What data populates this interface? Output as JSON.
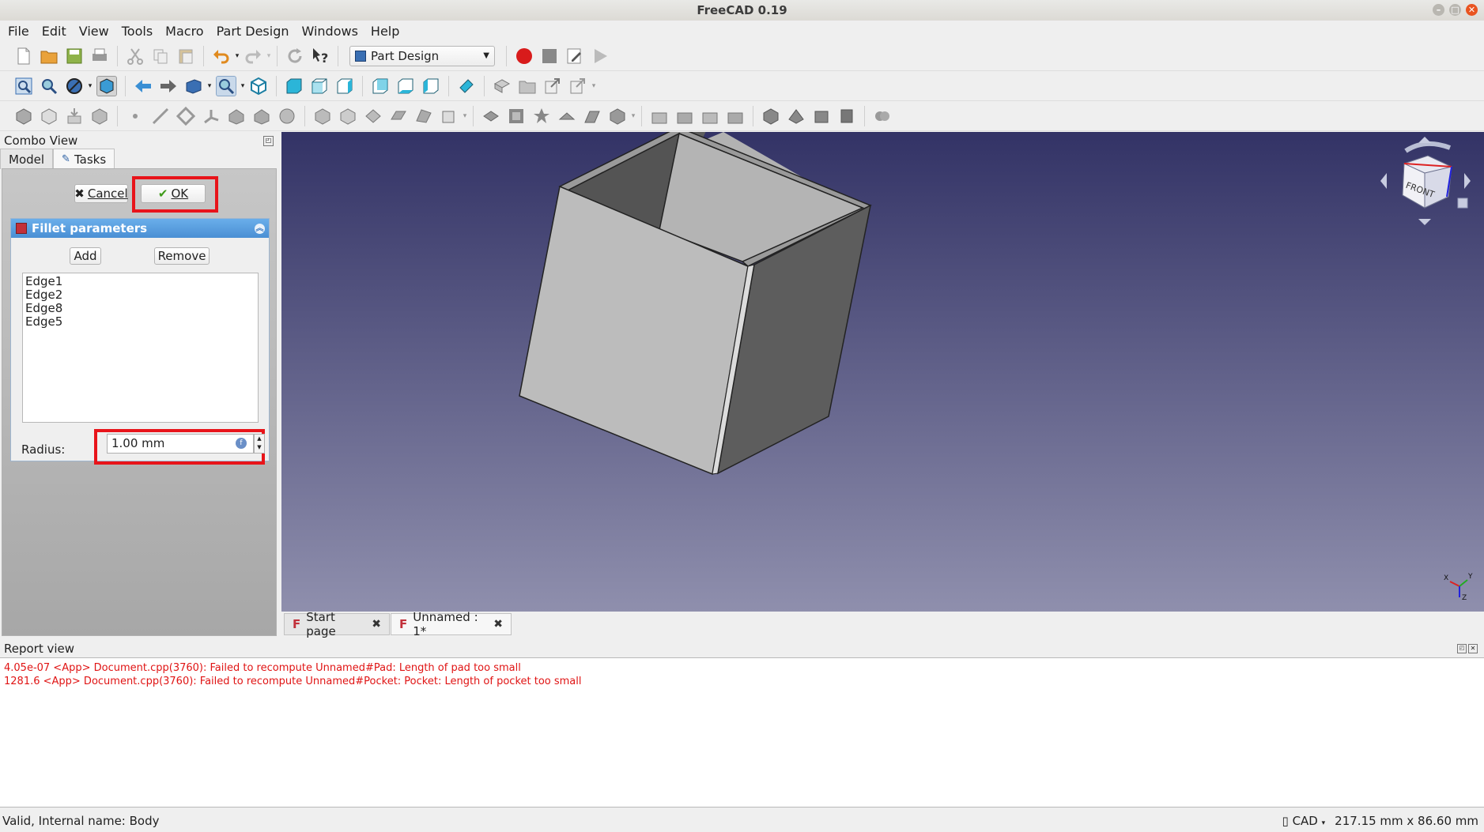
{
  "window": {
    "title": "FreeCAD 0.19"
  },
  "menu": [
    "File",
    "Edit",
    "View",
    "Tools",
    "Macro",
    "Part Design",
    "Windows",
    "Help"
  ],
  "workbench": {
    "selected": "Part Design"
  },
  "combo_view": {
    "title": "Combo View",
    "tabs": [
      "Model",
      "Tasks"
    ],
    "active_tab": "Tasks",
    "cancel_label": "Cancel",
    "ok_label": "OK",
    "fillet": {
      "title": "Fillet parameters",
      "add_label": "Add",
      "remove_label": "Remove",
      "edges": [
        "Edge1",
        "Edge2",
        "Edge8",
        "Edge5"
      ],
      "radius_label": "Radius:",
      "radius_value": "1.00 mm"
    }
  },
  "doc_tabs": [
    {
      "label": "Start page"
    },
    {
      "label": "Unnamed : 1*"
    }
  ],
  "nav_cube": {
    "face_label": "FRONT"
  },
  "report": {
    "title": "Report view",
    "lines": [
      "4.05e-07 <App> Document.cpp(3760): Failed to recompute Unnamed#Pad: Length of pad too small",
      "1281.6 <App> Document.cpp(3760): Failed to recompute Unnamed#Pocket: Pocket: Length of pocket too small"
    ]
  },
  "status": {
    "left": "Valid, Internal name: Body",
    "nav_style": "CAD",
    "dimensions": "217.15 mm x 86.60 mm"
  },
  "colors": {
    "viewport_top": "#333366",
    "viewport_bottom": "#8f8fad",
    "highlight": "#e8141a",
    "error_text": "#e01414",
    "panel_title": "#4a8fd4"
  }
}
